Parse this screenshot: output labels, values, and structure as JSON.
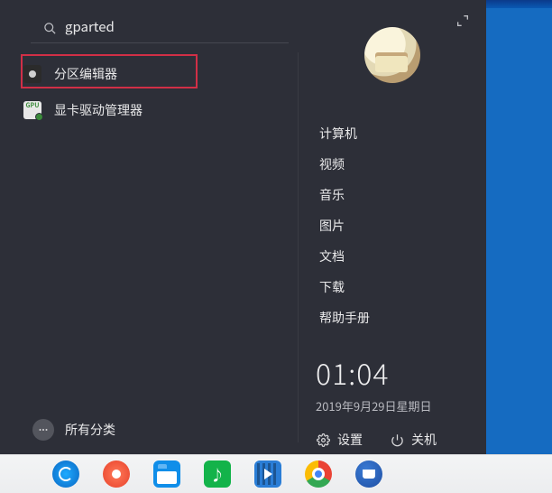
{
  "search": {
    "value": "gparted",
    "icon": "search-icon"
  },
  "results": [
    {
      "label": "分区编辑器",
      "icon": "disk-icon"
    },
    {
      "label": "显卡驱动管理器",
      "icon": "gpu-icon"
    }
  ],
  "left_bottom": {
    "all_categories": "所有分类"
  },
  "right": {
    "places": [
      "计算机",
      "视频",
      "音乐",
      "图片",
      "文档",
      "下载",
      "帮助手册"
    ],
    "clock": {
      "time": "01:04",
      "date": "2019年9月29日星期日"
    },
    "settings_label": "设置",
    "power_label": "关机"
  },
  "taskbar": {
    "items": [
      {
        "name": "launcher-deepin-icon"
      },
      {
        "name": "app-store-icon"
      },
      {
        "name": "file-manager-icon"
      },
      {
        "name": "music-icon"
      },
      {
        "name": "video-icon"
      },
      {
        "name": "chrome-icon"
      },
      {
        "name": "thunderbird-icon"
      }
    ]
  }
}
